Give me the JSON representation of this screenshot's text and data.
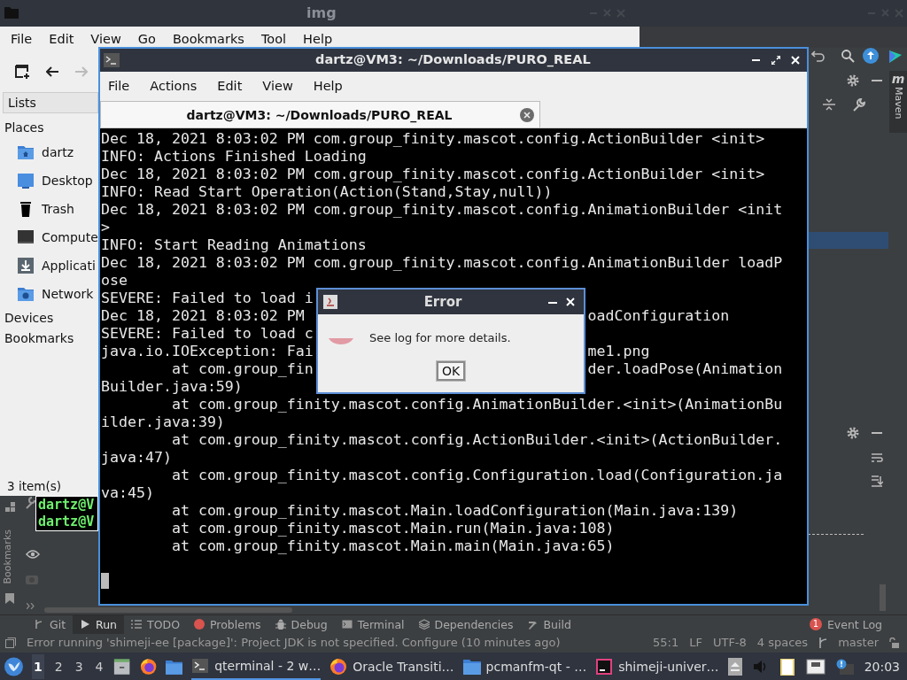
{
  "file_manager": {
    "title": "img",
    "menu": [
      "File",
      "Edit",
      "View",
      "Go",
      "Bookmarks",
      "Tool",
      "Help"
    ],
    "sidebar": {
      "dropdown": "Lists",
      "sections": [
        {
          "label": "Places",
          "items": [
            {
              "label": "dartz",
              "kind": "home"
            },
            {
              "label": "Desktop",
              "kind": "desktop"
            },
            {
              "label": "Trash",
              "kind": "trash"
            },
            {
              "label": "Compute",
              "kind": "computer"
            },
            {
              "label": "Applicati",
              "kind": "download"
            },
            {
              "label": "Network",
              "kind": "network"
            }
          ]
        },
        {
          "label": "Devices"
        },
        {
          "label": "Bookmarks"
        }
      ]
    },
    "status": "3 item(s)"
  },
  "back_terminal": {
    "lines": [
      "dartz@V",
      "dartz@V"
    ]
  },
  "terminal": {
    "title": "dartz@VM3: ~/Downloads/PURO_REAL",
    "menu": [
      "File",
      "Actions",
      "Edit",
      "View",
      "Help"
    ],
    "tab": {
      "label": "dartz@VM3: ~/Downloads/PURO_REAL",
      "selected": true
    },
    "lines": [
      {
        "text": "Dec 18, 2021 8:03:02 PM com.group_finity.mascot.config.ActionBuilder <init>"
      },
      {
        "text": "INFO: Actions Finished Loading"
      },
      {
        "text": "Dec 18, 2021 8:03:02 PM com.group_finity.mascot.config.ActionBuilder <init>"
      },
      {
        "text": "INFO: Read Start Operation(Action(Stand,Stay,null))"
      },
      {
        "text": "Dec 18, 2021 8:03:02 PM com.group_finity.mascot.config.AnimationBuilder <init"
      },
      {
        "text": ">"
      },
      {
        "text": "INFO: Start Reading Animations"
      },
      {
        "text": "Dec 18, 2021 8:03:02 PM com.group_finity.mascot.config.AnimationBuilder loadP"
      },
      {
        "text": "ose"
      },
      {
        "text": "SEVERE: Failed to load i"
      },
      {
        "text": "Dec 18, 2021 8:03:02 PM",
        "after": "oadConfiguration"
      },
      {
        "text": "SEVERE: Failed to load c"
      },
      {
        "text": "java.io.IOException: Fai",
        "after": "me1.png"
      },
      {
        "text": "        at com.group_fin",
        "after": "der.loadPose(Animation"
      },
      {
        "text": "Builder.java:59)"
      },
      {
        "text": "        at com.group_finity.mascot.config.AnimationBuilder.<init>(AnimationBu"
      },
      {
        "text": "ilder.java:39)"
      },
      {
        "text": "        at com.group_finity.mascot.config.ActionBuilder.<init>(ActionBuilder."
      },
      {
        "text": "java:47)"
      },
      {
        "text": "        at com.group_finity.mascot.config.Configuration.load(Configuration.ja"
      },
      {
        "text": "va:45)"
      },
      {
        "text": "        at com.group_finity.mascot.Main.loadConfiguration(Main.java:139)"
      },
      {
        "text": "        at com.group_finity.mascot.Main.run(Main.java:108)"
      },
      {
        "text": "        at com.group_finity.mascot.Main.main(Main.java:65)"
      }
    ]
  },
  "dialog": {
    "title": "Error",
    "message": "See log for more details.",
    "button": "OK"
  },
  "ide": {
    "side_tab": {
      "icon": "m",
      "label": "Maven"
    },
    "left_label": "Bookmarks",
    "tool_tabs": [
      {
        "label": "Git",
        "kind": "git",
        "selected": false
      },
      {
        "label": "Run",
        "kind": "run",
        "selected": true
      },
      {
        "label": "TODO",
        "kind": "todo",
        "selected": false
      },
      {
        "label": "Problems",
        "kind": "problems",
        "selected": false
      },
      {
        "label": "Debug",
        "kind": "debug",
        "selected": false
      },
      {
        "label": "Terminal",
        "kind": "terminal",
        "selected": false
      },
      {
        "label": "Dependencies",
        "kind": "dependencies",
        "selected": false
      },
      {
        "label": "Build",
        "kind": "build",
        "selected": false
      }
    ],
    "event_log": {
      "label": "Event Log",
      "count": "1"
    },
    "status": {
      "message": "Error running 'shimeji-ee [package]': Project JDK is not specified. Configure (10 minutes ago)",
      "items": [
        "55:1",
        "LF",
        "UTF-8",
        "4 spaces"
      ],
      "branch": "master"
    }
  },
  "taskbar": {
    "desktops": [
      {
        "label": "1",
        "selected": true
      },
      {
        "label": "2",
        "selected": false
      },
      {
        "label": "3",
        "selected": false
      },
      {
        "label": "4",
        "selected": false
      }
    ],
    "tasks": [
      {
        "label": "qterminal - 2 w…",
        "kind": "terminal",
        "selected": true
      },
      {
        "label": "Oracle Transiti…",
        "kind": "firefox",
        "selected": false
      },
      {
        "label": "pcmanfm-qt - …",
        "kind": "folder",
        "selected": false
      },
      {
        "label": "shimeji-univer…",
        "kind": "ide",
        "selected": false
      }
    ],
    "clock": "20:03"
  }
}
